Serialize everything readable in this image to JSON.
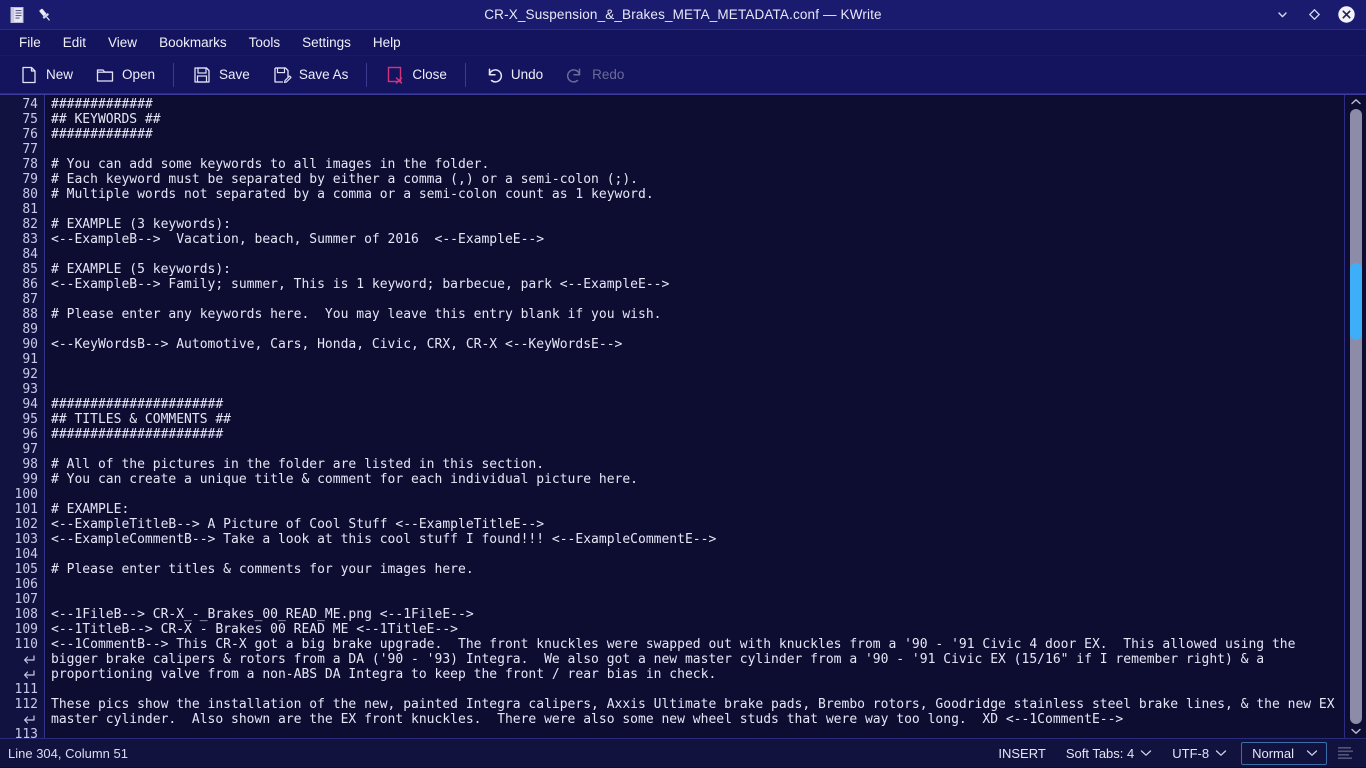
{
  "window": {
    "title": "CR-X_Suspension_&_Brakes_META_METADATA.conf — KWrite",
    "doc_icon": "document-icon",
    "pin_icon": "pin-icon",
    "minimize_icon": "chevron-down-icon",
    "maximize_icon": "diamond-icon",
    "close_icon": "close-circle-icon",
    "titlebar_bg": "#1a1a6e"
  },
  "menubar": {
    "items": [
      {
        "label": "File"
      },
      {
        "label": "Edit"
      },
      {
        "label": "View"
      },
      {
        "label": "Bookmarks"
      },
      {
        "label": "Tools"
      },
      {
        "label": "Settings"
      },
      {
        "label": "Help"
      }
    ]
  },
  "toolbar": {
    "new_label": "New",
    "open_label": "Open",
    "save_label": "Save",
    "save_as_label": "Save As",
    "close_label": "Close",
    "undo_label": "Undo",
    "redo_label": "Redo",
    "redo_disabled": true,
    "close_accent": "#d0347a"
  },
  "editor": {
    "first_line_number": 74,
    "font": "monospace",
    "background": "#0d0d32",
    "text_color": "#e6e6f6",
    "gutter_background": "#121240",
    "lines": [
      {
        "num": "74",
        "text": "#############"
      },
      {
        "num": "75",
        "text": "## KEYWORDS ##"
      },
      {
        "num": "76",
        "text": "#############"
      },
      {
        "num": "77",
        "text": ""
      },
      {
        "num": "78",
        "text": "# You can add some keywords to all images in the folder."
      },
      {
        "num": "79",
        "text": "# Each keyword must be separated by either a comma (,) or a semi-colon (;)."
      },
      {
        "num": "80",
        "text": "# Multiple words not separated by a comma or a semi-colon count as 1 keyword."
      },
      {
        "num": "81",
        "text": ""
      },
      {
        "num": "82",
        "text": "# EXAMPLE (3 keywords):"
      },
      {
        "num": "83",
        "text": "<--ExampleB-->  Vacation, beach, Summer of 2016  <--ExampleE-->"
      },
      {
        "num": "84",
        "text": ""
      },
      {
        "num": "85",
        "text": "# EXAMPLE (5 keywords):"
      },
      {
        "num": "86",
        "text": "<--ExampleB--> Family; summer, This is 1 keyword; barbecue, park <--ExampleE-->"
      },
      {
        "num": "87",
        "text": ""
      },
      {
        "num": "88",
        "text": "# Please enter any keywords here.  You may leave this entry blank if you wish."
      },
      {
        "num": "89",
        "text": ""
      },
      {
        "num": "90",
        "text": "<--KeyWordsB--> Automotive, Cars, Honda, Civic, CRX, CR-X <--KeyWordsE-->"
      },
      {
        "num": "91",
        "text": ""
      },
      {
        "num": "92",
        "text": ""
      },
      {
        "num": "93",
        "text": ""
      },
      {
        "num": "94",
        "text": "######################"
      },
      {
        "num": "95",
        "text": "## TITLES & COMMENTS ##"
      },
      {
        "num": "96",
        "text": "######################"
      },
      {
        "num": "97",
        "text": ""
      },
      {
        "num": "98",
        "text": "# All of the pictures in the folder are listed in this section."
      },
      {
        "num": "99",
        "text": "# You can create a unique title & comment for each individual picture here."
      },
      {
        "num": "100",
        "text": ""
      },
      {
        "num": "101",
        "text": "# EXAMPLE:"
      },
      {
        "num": "102",
        "text": "<--ExampleTitleB--> A Picture of Cool Stuff <--ExampleTitleE-->"
      },
      {
        "num": "103",
        "text": "<--ExampleCommentB--> Take a look at this cool stuff I found!!! <--ExampleCommentE-->"
      },
      {
        "num": "104",
        "text": ""
      },
      {
        "num": "105",
        "text": "# Please enter titles & comments for your images here."
      },
      {
        "num": "106",
        "text": ""
      },
      {
        "num": "107",
        "text": ""
      },
      {
        "num": "108",
        "text": "<--1FileB--> CR-X_-_Brakes_00_READ_ME.png <--1FileE-->"
      },
      {
        "num": "109",
        "text": "<--1TitleB--> CR-X - Brakes 00 READ ME <--1TitleE-->"
      },
      {
        "num": "110",
        "text": "<--1CommentB--> This CR-X got a big brake upgrade.  The front knuckles were swapped out with knuckles from a '90 - '91 Civic 4 door EX.  This allowed using the"
      },
      {
        "num": "",
        "wrap": true,
        "text": "bigger brake calipers & rotors from a DA ('90 - '93) Integra.  We also got a new master cylinder from a '90 - '91 Civic EX (15/16\" if I remember right) & a"
      },
      {
        "num": "",
        "wrap": true,
        "text": "proportioning valve from a non-ABS DA Integra to keep the front / rear bias in check."
      },
      {
        "num": "111",
        "text": ""
      },
      {
        "num": "112",
        "text": "These pics show the installation of the new, painted Integra calipers, Axxis Ultimate brake pads, Brembo rotors, Goodridge stainless steel brake lines, & the new EX"
      },
      {
        "num": "",
        "wrap": true,
        "text": "master cylinder.  Also shown are the EX front knuckles.  There were also some new wheel studs that were way too long.  XD <--1CommentE-->"
      },
      {
        "num": "113",
        "text": ""
      }
    ]
  },
  "scrollbar": {
    "up_arrow_icon": "chevron-up-icon",
    "down_arrow_icon": "chevron-down-icon",
    "thumb_color": "#3daef7",
    "track_color": "#8c8ca8",
    "thumb_top_pct": 25,
    "thumb_height_pct": 12.5
  },
  "statusbar": {
    "cursor_position": "Line 304, Column 51",
    "insert_mode": "INSERT",
    "tab_mode": "Soft Tabs: 4",
    "encoding": "UTF-8",
    "highlight_mode": "Normal",
    "align_icon": "text-lines-icon"
  }
}
